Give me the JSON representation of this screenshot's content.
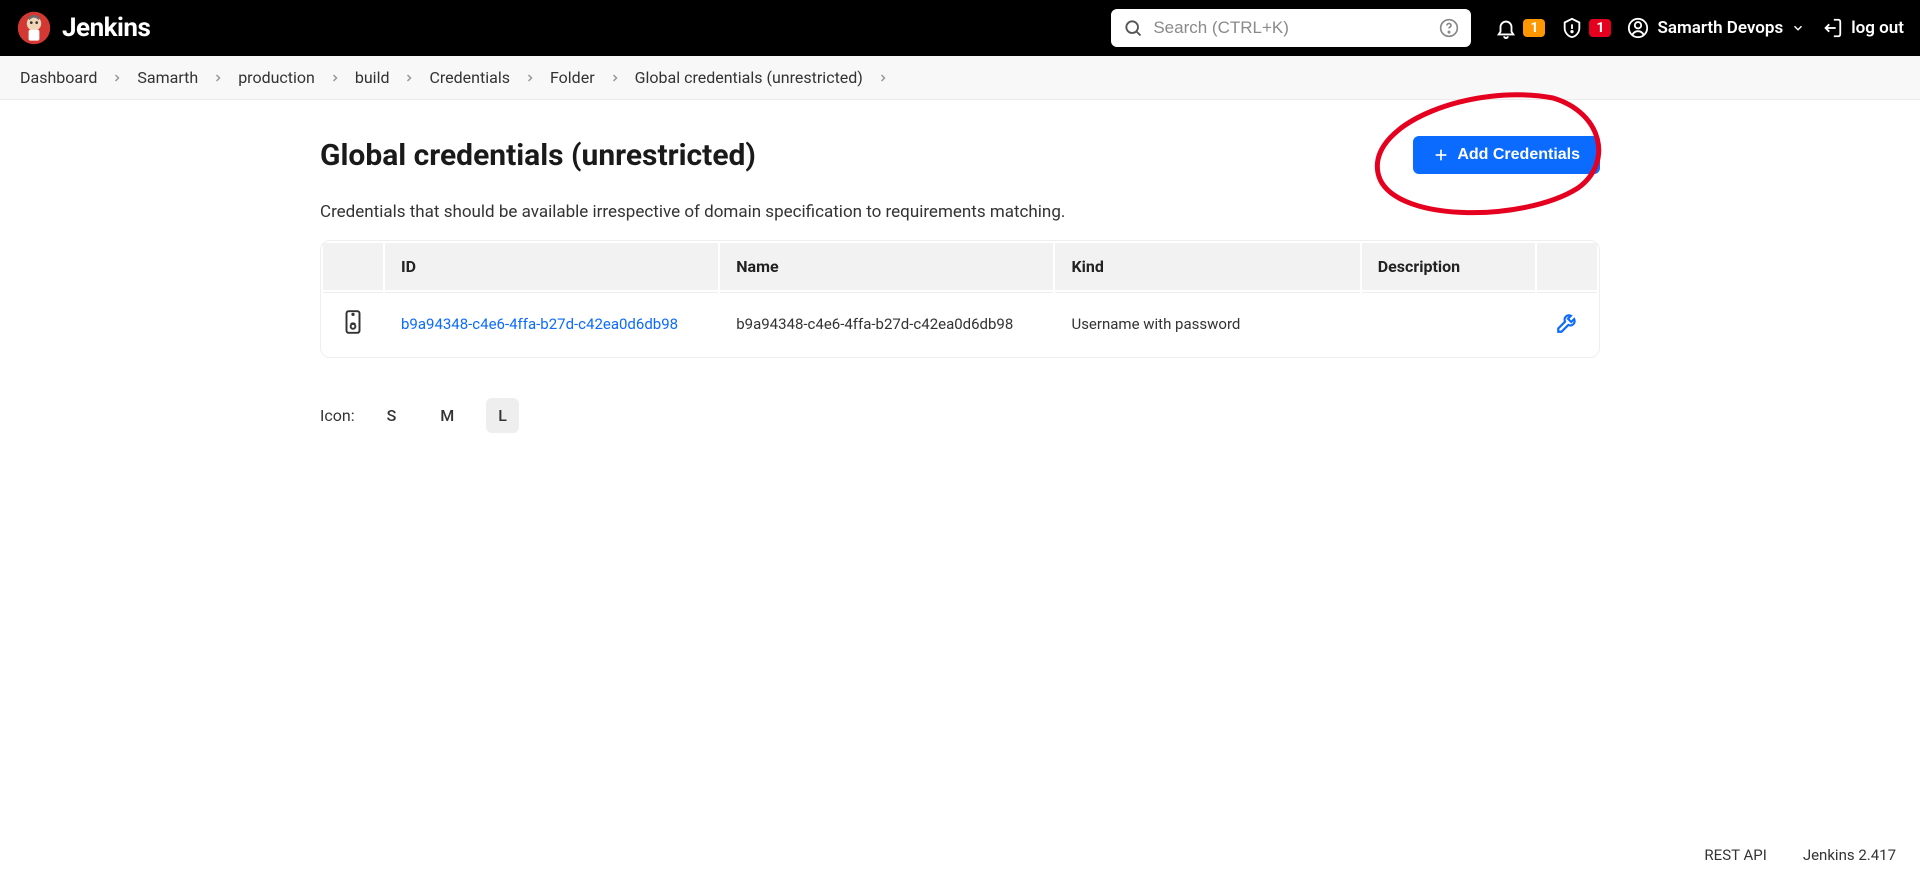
{
  "header": {
    "brand": "Jenkins",
    "search_placeholder": "Search (CTRL+K)",
    "notif_badge": "1",
    "security_badge": "1",
    "user_name": "Samarth Devops",
    "logout_label": "log out"
  },
  "breadcrumbs": [
    "Dashboard",
    "Samarth",
    "production",
    "build",
    "Credentials",
    "Folder",
    "Global credentials (unrestricted)"
  ],
  "page": {
    "title": "Global credentials (unrestricted)",
    "add_btn_label": "Add Credentials",
    "description": "Credentials that should be available irrespective of domain specification to requirements matching."
  },
  "table": {
    "headers": {
      "id": "ID",
      "name": "Name",
      "kind": "Kind",
      "description": "Description"
    },
    "rows": [
      {
        "id": "b9a94348-c4e6-4ffa-b27d-c42ea0d6db98",
        "name": "b9a94348-c4e6-4ffa-b27d-c42ea0d6db98",
        "kind": "Username with password",
        "description": ""
      }
    ]
  },
  "icon_size": {
    "label": "Icon:",
    "options": [
      "S",
      "M",
      "L"
    ],
    "active": "L"
  },
  "footer": {
    "rest_api": "REST API",
    "version": "Jenkins 2.417"
  }
}
